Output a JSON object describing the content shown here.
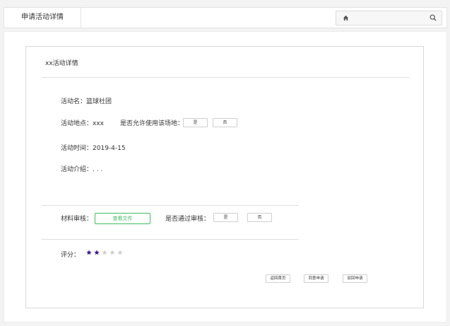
{
  "header": {
    "title": "申请活动详情",
    "search": {
      "placeholder": ""
    },
    "icons": {
      "home": "home-icon",
      "search": "search-icon"
    }
  },
  "card": {
    "title": "xx活动详情",
    "activity_name_label": "活动名：",
    "activity_name": "篮球社团",
    "location_label": "活动地点：",
    "location": "xxx",
    "allow_venue_label": "是否允许使用该场地：",
    "allow_yes": "是",
    "allow_no": "否",
    "time_label": "活动时间：",
    "time": "2019-4-15",
    "intro_label": "活动介绍：",
    "intro": ". . .",
    "material_label": "材料审核：",
    "view_file": "查看文件",
    "approve_label": "是否通过审核：",
    "approve_yes": "是",
    "approve_no": "否",
    "rating_label": "评分：",
    "rating": {
      "value": 2,
      "max": 5,
      "filled_color": "#3a1a8c",
      "empty_color": "#cfcfcf"
    },
    "actions": {
      "back_home": "返回首页",
      "agree": "同意申请",
      "reject": "驳回申请"
    }
  }
}
